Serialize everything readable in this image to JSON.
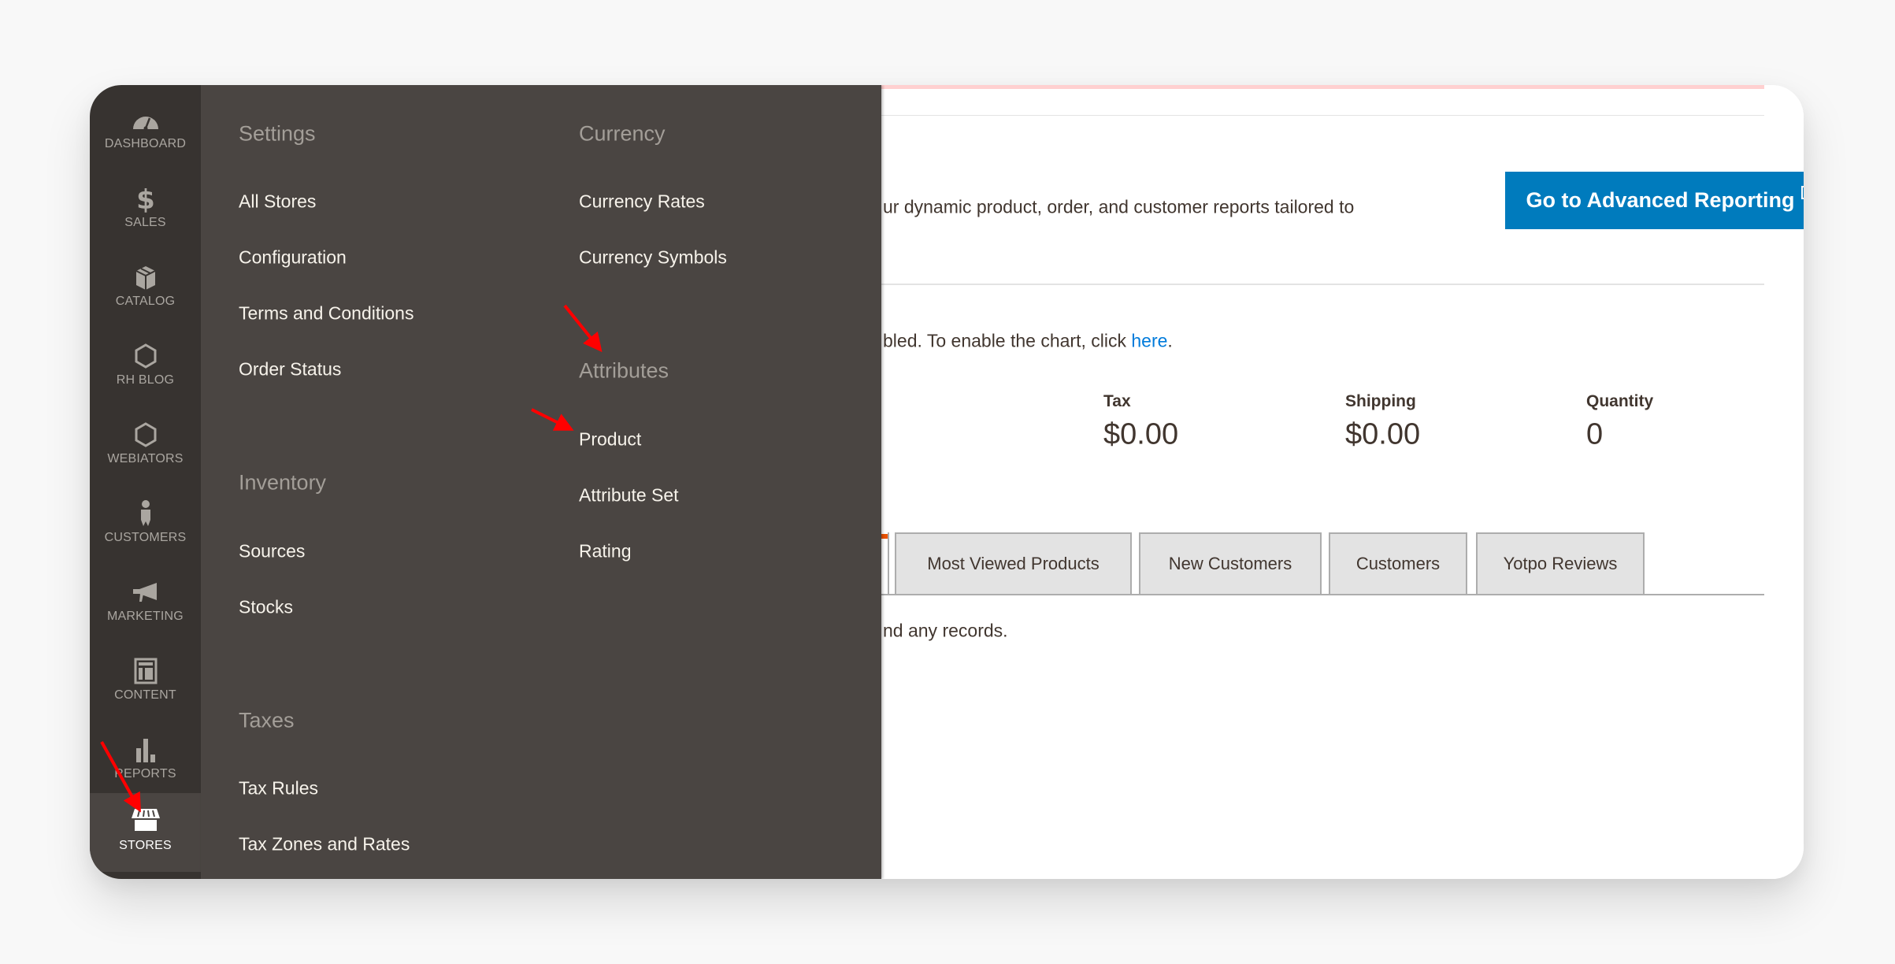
{
  "sidebar": {
    "items": [
      {
        "label": "DASHBOARD",
        "icon": "dashboard-icon",
        "active": false
      },
      {
        "label": "SALES",
        "icon": "dollar-icon",
        "active": false
      },
      {
        "label": "CATALOG",
        "icon": "box-icon",
        "active": false
      },
      {
        "label": "RH BLOG",
        "icon": "hexagon-icon",
        "active": false
      },
      {
        "label": "WEBIATORS",
        "icon": "hexagon-icon",
        "active": false
      },
      {
        "label": "CUSTOMERS",
        "icon": "person-icon",
        "active": false
      },
      {
        "label": "MARKETING",
        "icon": "megaphone-icon",
        "active": false
      },
      {
        "label": "CONTENT",
        "icon": "layout-icon",
        "active": false
      },
      {
        "label": "REPORTS",
        "icon": "bar-chart-icon",
        "active": false
      },
      {
        "label": "STORES",
        "icon": "store-icon",
        "active": true
      }
    ]
  },
  "stores_menu": {
    "settings": {
      "heading": "Settings",
      "links": [
        "All Stores",
        "Configuration",
        "Terms and Conditions",
        "Order Status"
      ]
    },
    "inventory": {
      "heading": "Inventory",
      "links": [
        "Sources",
        "Stocks"
      ]
    },
    "taxes": {
      "heading": "Taxes",
      "links": [
        "Tax Rules",
        "Tax Zones and Rates"
      ]
    },
    "currency": {
      "heading": "Currency",
      "links": [
        "Currency Rates",
        "Currency Symbols"
      ]
    },
    "attributes": {
      "heading": "Attributes",
      "links": [
        "Product",
        "Attribute Set",
        "Rating"
      ]
    }
  },
  "content": {
    "advanced_reporting_text": "ur dynamic product, order, and customer reports tailored to",
    "advanced_reporting_button": "Go to Advanced Reporting",
    "chart_notice_text": "bled. To enable the chart, click ",
    "chart_notice_link": "here",
    "chart_notice_end": ".",
    "stats": [
      {
        "label": "Tax",
        "value": "$0.00"
      },
      {
        "label": "Shipping",
        "value": "$0.00"
      },
      {
        "label": "Quantity",
        "value": "0"
      }
    ],
    "tabs": [
      "Most Viewed Products",
      "New Customers",
      "Customers",
      "Yotpo Reviews"
    ],
    "no_records_text": "nd any records."
  },
  "colors": {
    "sidebar_bg": "#373330",
    "menu_bg": "#4a4542",
    "primary_button": "#007bbd",
    "link": "#007bdb",
    "annotation_arrow": "#ff0000"
  }
}
